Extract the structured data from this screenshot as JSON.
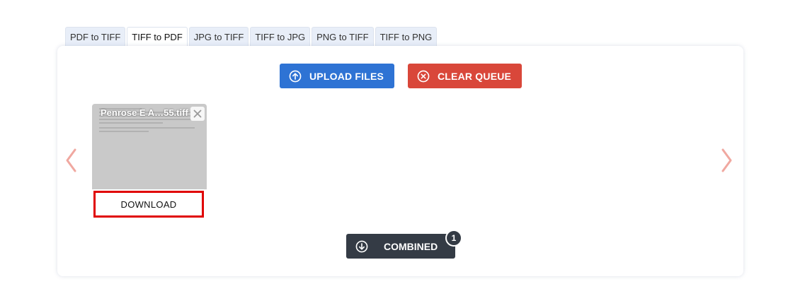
{
  "tabs": [
    {
      "label": "PDF to TIFF",
      "active": false
    },
    {
      "label": "TIFF to PDF",
      "active": true
    },
    {
      "label": "JPG to TIFF",
      "active": false
    },
    {
      "label": "TIFF to JPG",
      "active": false
    },
    {
      "label": "PNG to TIFF",
      "active": false
    },
    {
      "label": "TIFF to PNG",
      "active": false
    }
  ],
  "toolbar": {
    "upload_label": "UPLOAD FILES",
    "upload_icon": "upload-arrow-icon",
    "upload_color": "#2e73d4",
    "clear_label": "CLEAR QUEUE",
    "clear_icon": "close-circle-icon",
    "clear_color": "#d9473a"
  },
  "carousel": {
    "prev_icon": "chevron-left-icon",
    "next_icon": "chevron-right-icon",
    "arrow_color": "#f0a8a0"
  },
  "files": [
    {
      "name": "Penrose E A…55.tiff",
      "remove_icon": "close-icon",
      "download_label": "DOWNLOAD"
    }
  ],
  "combined": {
    "label": "COMBINED",
    "icon": "download-arrow-icon",
    "count": "1",
    "color": "#343b45"
  }
}
